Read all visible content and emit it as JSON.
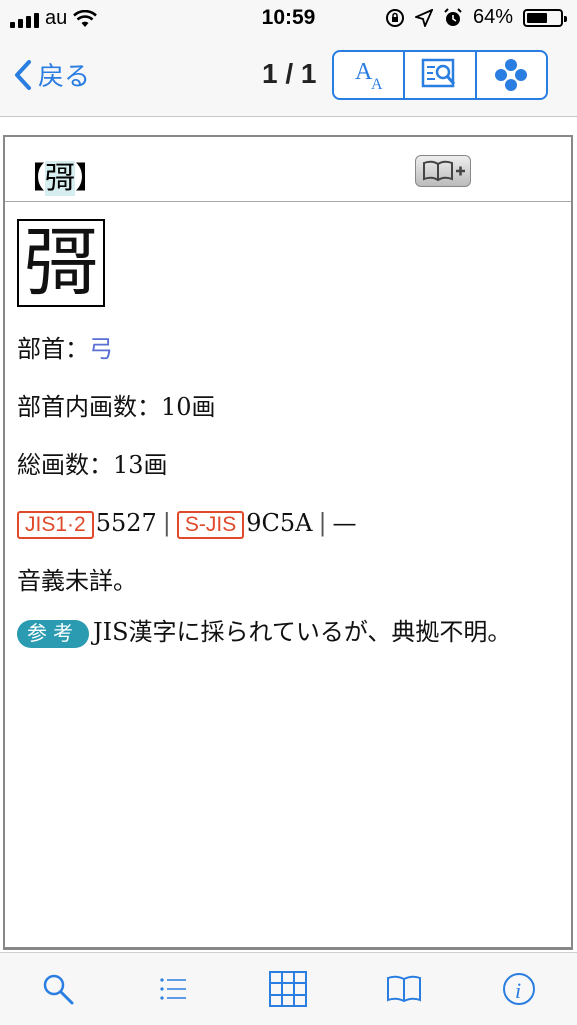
{
  "status": {
    "carrier": "au",
    "time": "10:59",
    "battery": "64%",
    "battery_level": 0.64
  },
  "nav": {
    "back_label": "戻る",
    "page_count": "1 / 1",
    "buttons": [
      "font-size-icon",
      "search-in-page-icon",
      "options-icon"
    ]
  },
  "entry": {
    "headword_open": "【",
    "headword_char": "彁",
    "headword_close": "】",
    "big_char": "彁",
    "radical_label": "部首：",
    "radical_value": "弓",
    "inner_strokes": "部首内画数：10画",
    "total_strokes": "総画数：13画",
    "jis_tag": "JIS1·2",
    "jis_value": "5527",
    "sep1": "|",
    "sjis_tag": "S-JIS",
    "sjis_value": "9C5A",
    "sep2": "|",
    "unicode_value": "—",
    "meaning": "音義未詳。",
    "ref_tag": "参考",
    "ref_text": "JIS漢字に採られているが、典拠不明。"
  },
  "tabs": [
    "search-icon",
    "list-icon",
    "grid-icon",
    "book-icon",
    "info-icon"
  ],
  "colors": {
    "accent": "#2a7de1",
    "tag_red": "#e04a2a",
    "tag_ref": "#2a9bb0",
    "radical": "#5a6fd6"
  }
}
